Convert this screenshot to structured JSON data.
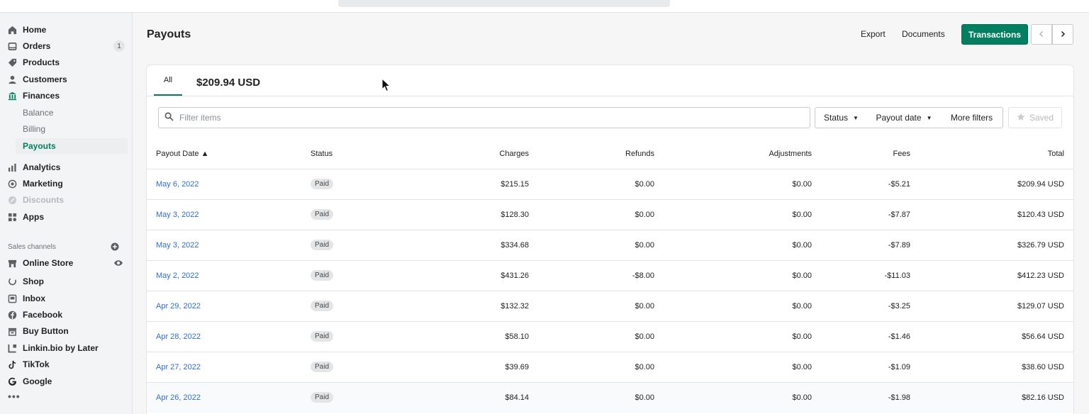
{
  "sidebar": {
    "items": [
      {
        "label": "Home",
        "icon": "home-icon"
      },
      {
        "label": "Orders",
        "icon": "orders-icon",
        "badge": "1"
      },
      {
        "label": "Products",
        "icon": "tag-icon"
      },
      {
        "label": "Customers",
        "icon": "person-icon"
      },
      {
        "label": "Finances",
        "icon": "bank-icon"
      },
      {
        "label": "Balance"
      },
      {
        "label": "Billing"
      },
      {
        "label": "Payouts"
      },
      {
        "label": "Analytics",
        "icon": "bar-chart-icon"
      },
      {
        "label": "Marketing",
        "icon": "target-icon"
      },
      {
        "label": "Discounts",
        "icon": "discount-icon"
      },
      {
        "label": "Apps",
        "icon": "apps-icon"
      }
    ],
    "sales_channels_label": "Sales channels",
    "channels": [
      {
        "label": "Online Store",
        "icon": "store-icon"
      },
      {
        "label": "Shop",
        "icon": "shop-icon"
      },
      {
        "label": "Inbox",
        "icon": "inbox-icon"
      },
      {
        "label": "Facebook",
        "icon": "facebook-icon"
      },
      {
        "label": "Buy Button",
        "icon": "buy-button-icon"
      },
      {
        "label": "Linkin.bio by Later",
        "icon": "linkinbio-icon"
      },
      {
        "label": "TikTok",
        "icon": "tiktok-icon"
      },
      {
        "label": "Google",
        "icon": "google-icon"
      }
    ],
    "more": "•••"
  },
  "header": {
    "title": "Payouts",
    "export_label": "Export",
    "documents_label": "Documents",
    "transactions_label": "Transactions"
  },
  "card": {
    "tab_all": "All",
    "amount": "$209.94 USD",
    "filter_placeholder": "Filter items",
    "status_label": "Status",
    "payout_date_label": "Payout date",
    "more_filters_label": "More filters",
    "saved_label": "Saved"
  },
  "table": {
    "columns": [
      "Payout Date ▲",
      "Status",
      "Charges",
      "Refunds",
      "Adjustments",
      "Fees",
      "Total"
    ],
    "rows": [
      {
        "date": "May 6, 2022",
        "status": "Paid",
        "charges": "$215.15",
        "refunds": "$0.00",
        "adjustments": "$0.00",
        "fees": "-$5.21",
        "total": "$209.94 USD"
      },
      {
        "date": "May 3, 2022",
        "status": "Paid",
        "charges": "$128.30",
        "refunds": "$0.00",
        "adjustments": "$0.00",
        "fees": "-$7.87",
        "total": "$120.43 USD"
      },
      {
        "date": "May 3, 2022",
        "status": "Paid",
        "charges": "$334.68",
        "refunds": "$0.00",
        "adjustments": "$0.00",
        "fees": "-$7.89",
        "total": "$326.79 USD"
      },
      {
        "date": "May 2, 2022",
        "status": "Paid",
        "charges": "$431.26",
        "refunds": "-$8.00",
        "adjustments": "$0.00",
        "fees": "-$11.03",
        "total": "$412.23 USD"
      },
      {
        "date": "Apr 29, 2022",
        "status": "Paid",
        "charges": "$132.32",
        "refunds": "$0.00",
        "adjustments": "$0.00",
        "fees": "-$3.25",
        "total": "$129.07 USD"
      },
      {
        "date": "Apr 28, 2022",
        "status": "Paid",
        "charges": "$58.10",
        "refunds": "$0.00",
        "adjustments": "$0.00",
        "fees": "-$1.46",
        "total": "$56.64 USD"
      },
      {
        "date": "Apr 27, 2022",
        "status": "Paid",
        "charges": "$39.69",
        "refunds": "$0.00",
        "adjustments": "$0.00",
        "fees": "-$1.09",
        "total": "$38.60 USD"
      },
      {
        "date": "Apr 26, 2022",
        "status": "Paid",
        "charges": "$84.14",
        "refunds": "$0.00",
        "adjustments": "$0.00",
        "fees": "-$1.98",
        "total": "$82.16 USD"
      }
    ]
  },
  "colors": {
    "accent": "#008060",
    "link": "#2c6ecb"
  }
}
